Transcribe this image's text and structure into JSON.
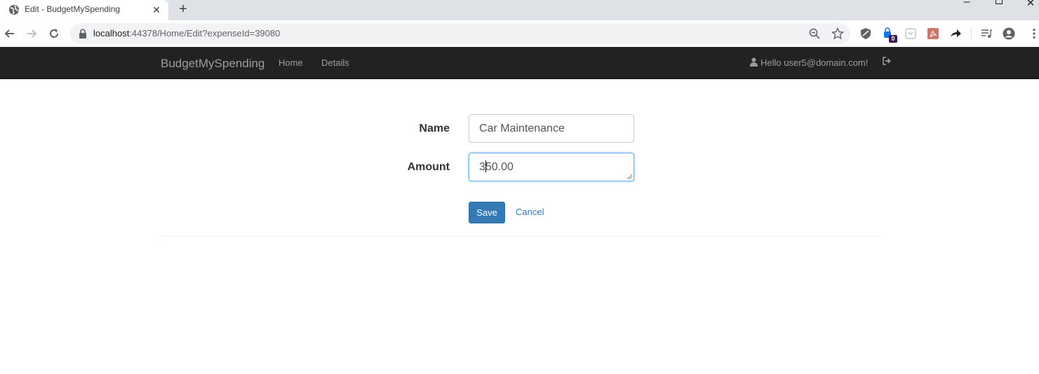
{
  "browser": {
    "tab_title": "Edit - BudgetMySpending",
    "url_host": "localhost",
    "url_path": ":44378/Home/Edit?expenseId=39080",
    "extension_badge": "0"
  },
  "navbar": {
    "brand": "BudgetMySpending",
    "links": [
      "Home",
      "Details"
    ],
    "greeting": "Hello user5@domain.com!"
  },
  "form": {
    "name_label": "Name",
    "name_value": "Car Maintenance",
    "amount_label": "Amount",
    "amount_value_before_caret": "3",
    "amount_value_after_caret": "50.00",
    "save_label": "Save",
    "cancel_label": "Cancel"
  },
  "colors": {
    "navbar_bg": "#222222",
    "primary": "#337ab7",
    "focus_border": "#66afe9"
  }
}
